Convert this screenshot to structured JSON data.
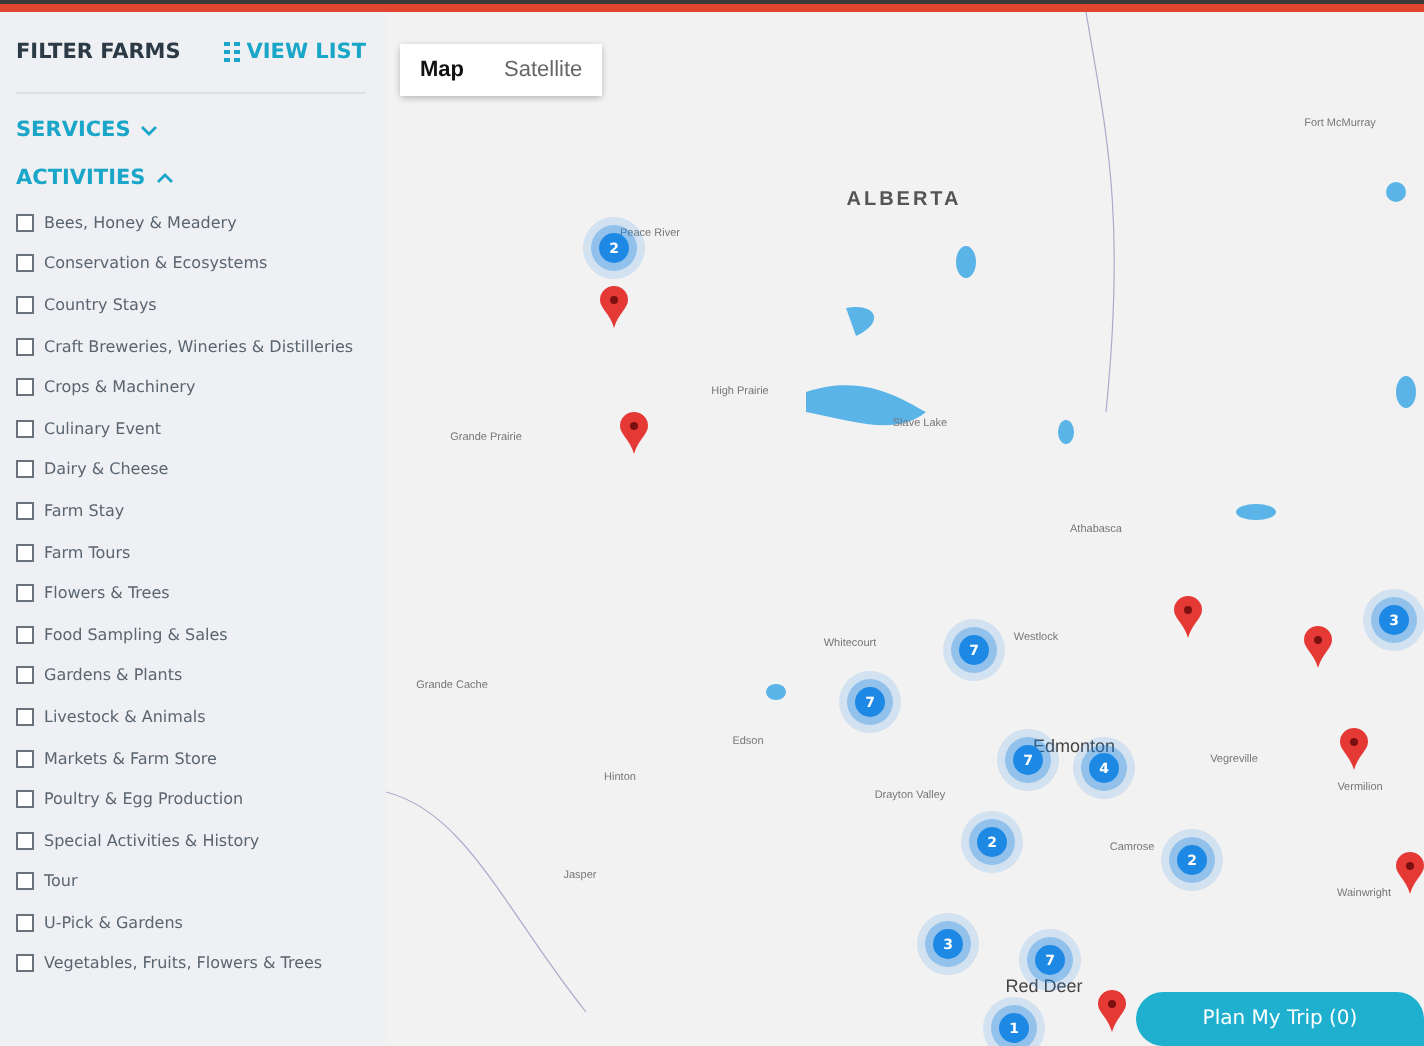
{
  "sidebar": {
    "title": "FILTER FARMS",
    "view_list": "VIEW LIST",
    "sections": [
      {
        "label": "SERVICES",
        "expanded": false
      },
      {
        "label": "ACTIVITIES",
        "expanded": true,
        "items": [
          {
            "label": "Bees, Honey & Meadery",
            "checked": false
          },
          {
            "label": "Conservation & Ecosystems",
            "checked": false
          },
          {
            "label": "Country Stays",
            "checked": false
          },
          {
            "label": "Craft Breweries, Wineries & Distilleries",
            "checked": false
          },
          {
            "label": "Crops & Machinery",
            "checked": false
          },
          {
            "label": "Culinary Event",
            "checked": false
          },
          {
            "label": "Dairy & Cheese",
            "checked": false
          },
          {
            "label": "Farm Stay",
            "checked": false
          },
          {
            "label": "Farm Tours",
            "checked": false
          },
          {
            "label": "Flowers & Trees",
            "checked": false
          },
          {
            "label": "Food Sampling & Sales",
            "checked": false
          },
          {
            "label": "Gardens & Plants",
            "checked": false
          },
          {
            "label": "Livestock & Animals",
            "checked": false
          },
          {
            "label": "Markets & Farm Store",
            "checked": false
          },
          {
            "label": "Poultry & Egg Production",
            "checked": false
          },
          {
            "label": "Special Activities & History",
            "checked": false
          },
          {
            "label": "Tour",
            "checked": false
          },
          {
            "label": "U-Pick & Gardens",
            "checked": false
          },
          {
            "label": "Vegetables, Fruits, Flowers & Trees",
            "checked": false
          }
        ]
      }
    ]
  },
  "map": {
    "map_types": [
      {
        "label": "Map",
        "selected": true
      },
      {
        "label": "Satellite",
        "selected": false
      }
    ],
    "places": [
      {
        "label": "ALBERTA",
        "kind": "region"
      },
      {
        "label": "Fort McMurray",
        "kind": "town"
      },
      {
        "label": "Peace River",
        "kind": "town"
      },
      {
        "label": "High Prairie",
        "kind": "town"
      },
      {
        "label": "Slave Lake",
        "kind": "town"
      },
      {
        "label": "Grande Prairie",
        "kind": "town"
      },
      {
        "label": "Athabasca",
        "kind": "town"
      },
      {
        "label": "Whitecourt",
        "kind": "town"
      },
      {
        "label": "Westlock",
        "kind": "town"
      },
      {
        "label": "Grande Cache",
        "kind": "town"
      },
      {
        "label": "Edmonton",
        "kind": "city"
      },
      {
        "label": "Hinton",
        "kind": "town"
      },
      {
        "label": "Edson",
        "kind": "town"
      },
      {
        "label": "Drayton Valley",
        "kind": "town"
      },
      {
        "label": "Vegreville",
        "kind": "town"
      },
      {
        "label": "Camrose",
        "kind": "town"
      },
      {
        "label": "Jasper",
        "kind": "town"
      },
      {
        "label": "Red Deer",
        "kind": "city"
      },
      {
        "label": "Vermilion",
        "kind": "town"
      },
      {
        "label": "Wainwright",
        "kind": "town"
      }
    ],
    "clusters": [
      "2",
      "7",
      "7",
      "7",
      "4",
      "2",
      "2",
      "3",
      "7",
      "1",
      "3"
    ]
  },
  "plan_button": "Plan My Trip (0)"
}
